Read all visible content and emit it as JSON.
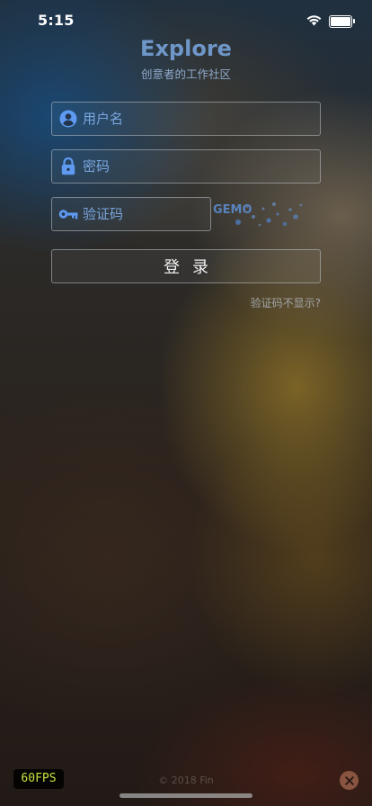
{
  "status_bar": {
    "time": "5:15"
  },
  "header": {
    "title": "Explore",
    "subtitle": "创意者的工作社区"
  },
  "login_form": {
    "username": {
      "placeholder": "用户名",
      "value": "",
      "icon": "user-circle-icon"
    },
    "password": {
      "placeholder": "密码",
      "value": "",
      "icon": "lock-icon"
    },
    "captcha": {
      "placeholder": "验证码",
      "value": "",
      "icon": "key-icon",
      "image_text": "GEMO"
    },
    "login_button_label": "登录",
    "captcha_hint": "验证码不显示?"
  },
  "footer": {
    "fps": "60FPS",
    "copyright": "© 2018 Fin"
  },
  "colors": {
    "accent": "#6e96c8",
    "placeholder": "#7aa6de",
    "fps_text": "#c8e23a",
    "close_button": "#8a5540"
  }
}
